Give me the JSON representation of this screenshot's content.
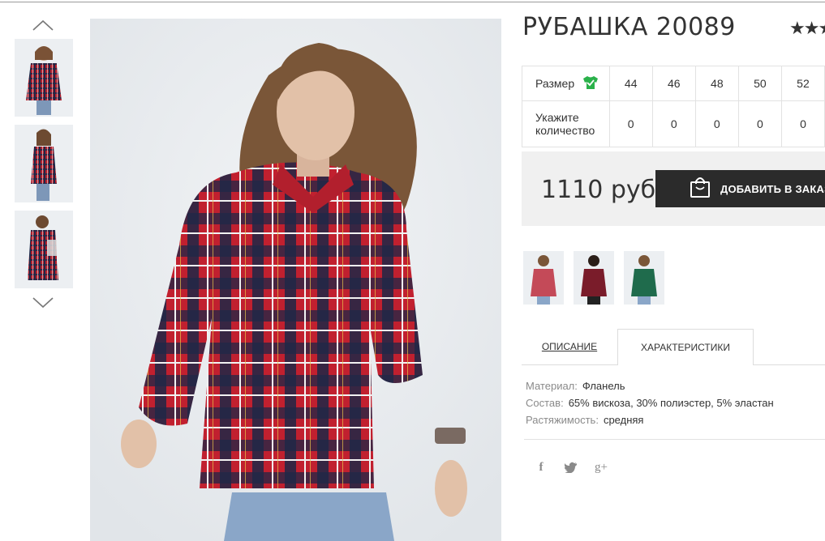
{
  "product": {
    "title": "РУБАШКА 20089",
    "rating_stars": "★★★"
  },
  "size_table": {
    "size_label": "Размер",
    "quantity_label_line1": "Укажите",
    "quantity_label_line2": "количество",
    "sizes": [
      "44",
      "46",
      "48",
      "50",
      "52"
    ],
    "quantities": [
      "0",
      "0",
      "0",
      "0",
      "0"
    ]
  },
  "buy": {
    "price": "1110 руб",
    "add_button_label": "ДОБАВИТЬ В ЗАКАЗ"
  },
  "tabs": {
    "description": "ОПИСАНИЕ",
    "characteristics": "ХАРАКТЕРИСТИКИ"
  },
  "specs": [
    {
      "key": "Материал:",
      "value": "Фланель"
    },
    {
      "key": "Состав:",
      "value": "65% вискоза, 30% полиэстер, 5% эластан"
    },
    {
      "key": "Растяжимость:",
      "value": "средняя"
    }
  ],
  "social": {
    "facebook": "f",
    "twitter": "t",
    "googleplus": "g+"
  },
  "colors": {
    "shirt_red": "#b21f2d",
    "shirt_navy": "#1f2747",
    "shirt_green": "#1f6b4c",
    "size_icon_green": "#2ab14a",
    "button_dark": "#2b2b2b"
  },
  "icons": [
    "chevron-up-icon",
    "chevron-down-icon",
    "shirt-check-icon",
    "shopping-bag-icon",
    "facebook-icon",
    "twitter-icon",
    "google-plus-icon"
  ]
}
